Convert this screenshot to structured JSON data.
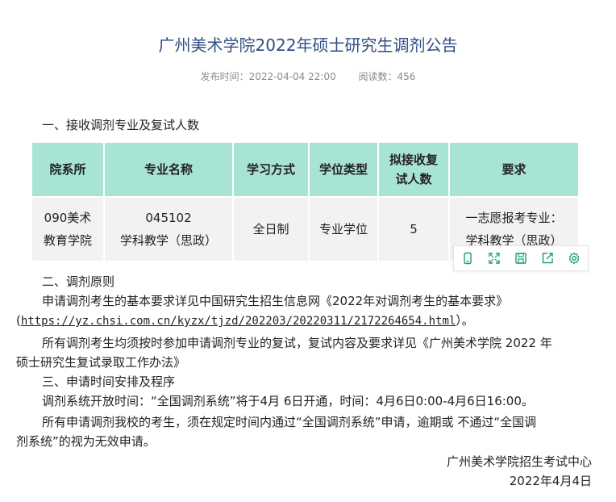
{
  "title": "广州美术学院2022年硕士研究生调剂公告",
  "meta": {
    "publish_label": "发布时间：2022-04-04 22:00",
    "views_label": "阅读数：456"
  },
  "section1": "一、接收调剂专业及复试人数",
  "table": {
    "headers": [
      "院系所",
      "专业名称",
      "学习方式",
      "学位类型",
      "拟接收复试人数",
      "要求"
    ],
    "header_lines": {
      "h4a": "拟接收复",
      "h4b": "试人数"
    },
    "row": {
      "dept_a": "090美术",
      "dept_b": "教育学院",
      "major_code": "045102",
      "major_name": "学科教学（思政）",
      "mode": "全日制",
      "degree": "专业学位",
      "count": "5",
      "req_a": "一志愿报考专业：",
      "req_b": "学科教学（思政）"
    }
  },
  "section2": "二、调剂原则",
  "para1": {
    "text": "申请调剂考生的基本要求详见中国研究生招生信息网《2022年对调剂考生的基本要求》",
    "open": "(",
    "link": "https://yz.chsi.com.cn/kyzx/tjzd/202203/20220311/2172264654.html",
    "close": "）。"
  },
  "para2": {
    "line1": "所有调剂考生均须按时参加申请调剂专业的复试，复试内容及要求详见《广州美术学院 2022 年",
    "line2": "硕士研究生复试录取工作办法》"
  },
  "section3": "三、申请时间安排及程序",
  "para3": "调剂系统开放时间：“全国调剂系统”将于4月 6日开通，时间：4月6日0:00-4月6日16:00。",
  "para4": {
    "line1": "所有申请调剂我校的考生，须在规定时间内通过“全国调剂系统”申请，逾期或 不通过“全国调",
    "line2": "剂系统”的视为无效申请。"
  },
  "signature": {
    "org": "广州美术学院招生考试中心",
    "date": "2022年4月4日"
  },
  "toolbar_icons": [
    "mobile-icon",
    "fullscreen-icon",
    "save-icon",
    "share-icon",
    "settings-icon"
  ],
  "accent_color": "#1a9c7a",
  "header_bg": "#a8e4d4"
}
